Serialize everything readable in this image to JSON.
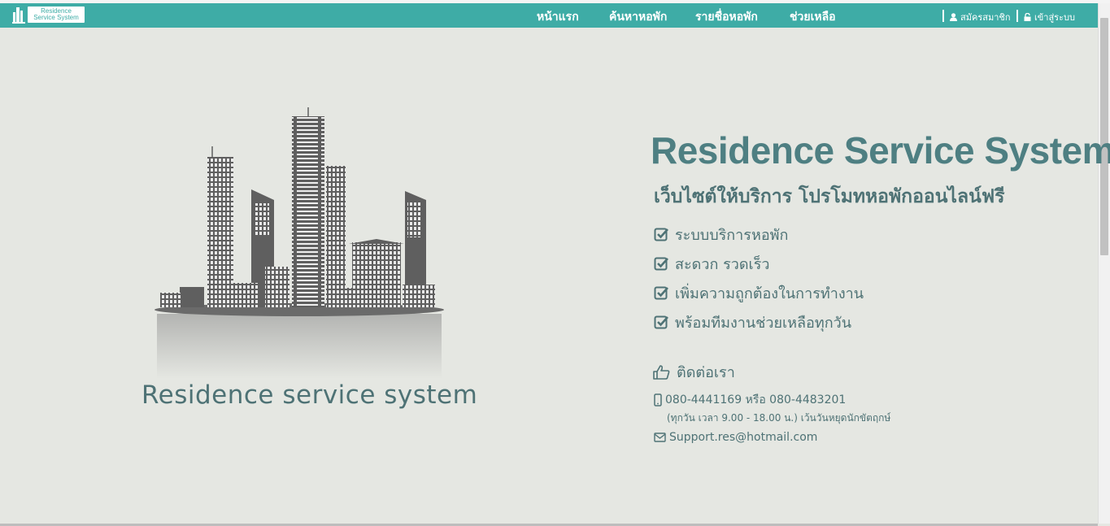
{
  "navbar": {
    "logo_line1": "Residence",
    "logo_line2": "Service System",
    "links": [
      "หน้าแรก",
      "ค้นหาหอพัก",
      "รายชื่อหอพัก",
      "ช่วยเหลือ"
    ],
    "register": "สมัครสมาชิก",
    "login": "เข้าสู่ระบบ",
    "bg_color": "#3eaca6"
  },
  "hero": {
    "caption": "Residence service system",
    "title": "Residence Service System",
    "subtitle": "เว็บไซต์ให้บริการ โปรโมทหอพักออนไลน์ฟรี",
    "features": [
      "ระบบบริการหอพัก",
      "สะดวก รวดเร็ว",
      "เพิ่มความถูกต้องในการทำงาน",
      "พร้อมทีมงานช่วยเหลือทุกวัน"
    ]
  },
  "contact": {
    "heading": "ติดต่อเรา",
    "phone": "080-4441169 หรือ 080-4483201",
    "hours": "(ทุกวัน เวลา 9.00 - 18.00 น.) เว้นวันหยุดนักขัตฤกษ์",
    "email": "Support.res@hotmail.com"
  },
  "icons": {
    "check": "check-square-icon",
    "contact": "thumbs-up-icon",
    "phone": "mobile-phone-icon",
    "email": "envelope-icon",
    "user": "user-icon",
    "lock": "lock-icon"
  }
}
